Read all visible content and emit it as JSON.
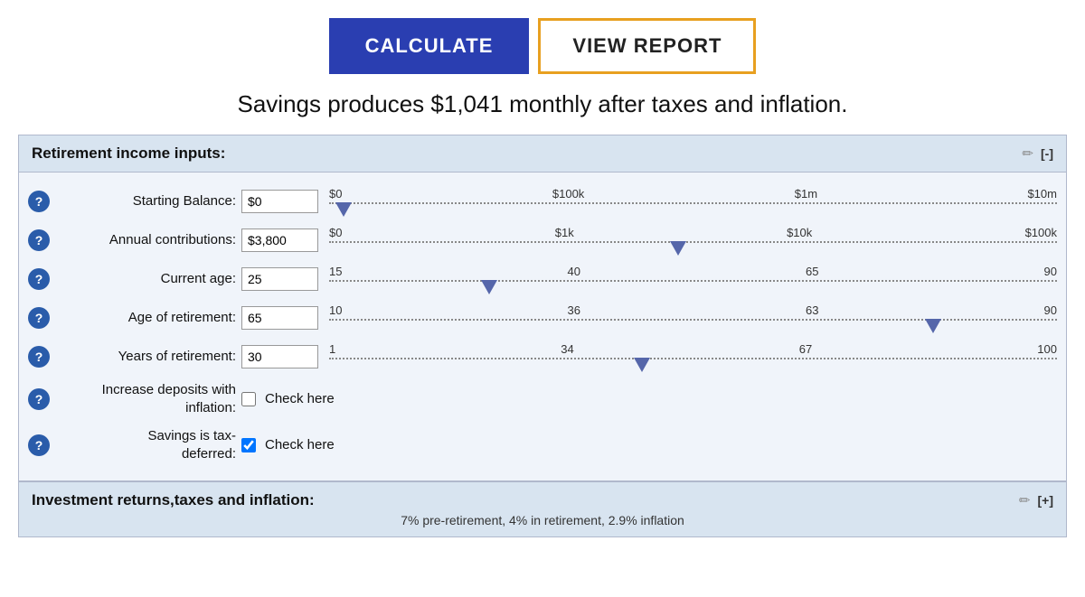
{
  "buttons": {
    "calculate_label": "CALCULATE",
    "view_report_label": "VIEW REPORT"
  },
  "result": {
    "text": "Savings produces $1,041 monthly after taxes and inflation."
  },
  "retirement_section": {
    "title": "Retirement income inputs:",
    "edit_icon": "✏",
    "collapse_btn": "[-]",
    "fields": [
      {
        "id": "starting-balance",
        "label": "Starting Balance:",
        "value": "$0",
        "slider_labels": [
          "$0",
          "$100k",
          "$1m",
          "$10m"
        ],
        "thumb_pct": 2
      },
      {
        "id": "annual-contributions",
        "label": "Annual contributions:",
        "value": "$3,800",
        "slider_labels": [
          "$0",
          "$1k",
          "$10k",
          "$100k"
        ],
        "thumb_pct": 45
      },
      {
        "id": "current-age",
        "label": "Current age:",
        "value": "25",
        "slider_labels": [
          "15",
          "40",
          "65",
          "90"
        ],
        "thumb_pct": 22
      },
      {
        "id": "age-of-retirement",
        "label": "Age of retirement:",
        "value": "65",
        "slider_labels": [
          "10",
          "36",
          "63",
          "90"
        ],
        "thumb_pct": 84
      },
      {
        "id": "years-of-retirement",
        "label": "Years of retirement:",
        "value": "30",
        "slider_labels": [
          "1",
          "34",
          "67",
          "100"
        ],
        "thumb_pct": 43
      }
    ],
    "increase_deposits": {
      "label_line1": "Increase deposits with",
      "label_line2": "inflation:",
      "checked": false,
      "check_label": "Check here"
    },
    "savings_tax": {
      "label_line1": "Savings is tax-",
      "label_line2": "deferred:",
      "checked": true,
      "check_label": "Check here"
    }
  },
  "investment_section": {
    "title": "Investment returns,taxes and inflation:",
    "edit_icon": "✏",
    "expand_btn": "[+]",
    "subtitle": "7% pre-retirement, 4% in retirement, 2.9% inflation"
  }
}
